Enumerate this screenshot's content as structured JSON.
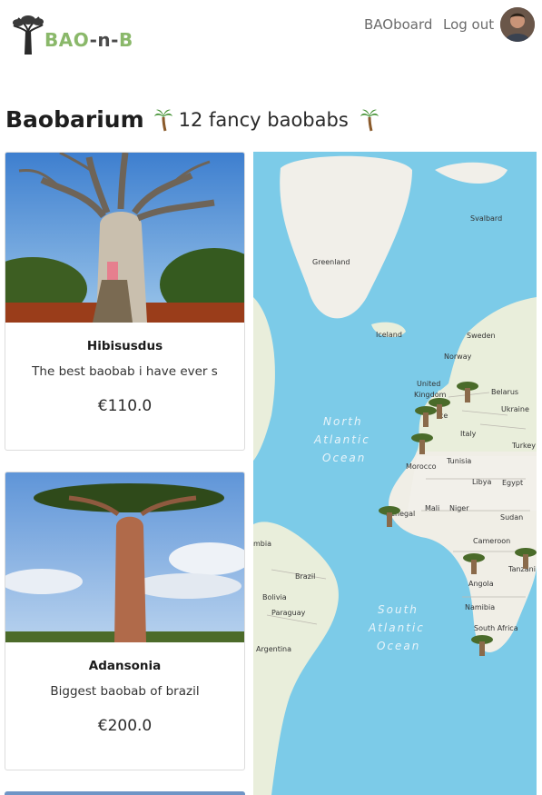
{
  "brand": {
    "name": "BAO-n-B",
    "part1": "BAO",
    "part2": "-n-",
    "part3": "B"
  },
  "nav": {
    "dashboard_label": "BAOboard",
    "logout_label": "Log out"
  },
  "header": {
    "title": "Baobarium",
    "subtitle": "12 fancy baobabs"
  },
  "listings": [
    {
      "name": "Hibisusdus",
      "description": "The best baobab i have ever s",
      "price": "€110.0"
    },
    {
      "name": "Adansonia",
      "description": "Biggest baobab of brazil",
      "price": "€200.0"
    }
  ],
  "map": {
    "labels": {
      "svalbard": "Svalbard",
      "greenland": "Greenland",
      "iceland": "Iceland",
      "sweden": "Sweden",
      "norway": "Norway",
      "uk1": "United",
      "uk2": "Kingdom",
      "belarus": "Belarus",
      "ukraine": "Ukraine",
      "france": "ce",
      "italy": "Italy",
      "turkey": "Turkey",
      "morocco": "Morocco",
      "tunisia": "Tunisia",
      "libya": "Libya",
      "egypt": "Egypt",
      "mali": "Mali",
      "niger": "Niger",
      "sudan": "Sudan",
      "senegal": "Senegal",
      "cameroon": "Cameroon",
      "angola": "Angola",
      "namibia": "Namibia",
      "south_africa": "South Africa",
      "tanzania": "Tanzani",
      "brazil": "Brazil",
      "bolivia": "Bolivia",
      "paraguay": "Paraguay",
      "argentina": "Argentina",
      "colombia": "mbia",
      "north1": "North",
      "north2": "Atlantic",
      "north3": "Ocean",
      "south1": "South",
      "south2": "Atlantic",
      "south3": "Ocean"
    }
  }
}
